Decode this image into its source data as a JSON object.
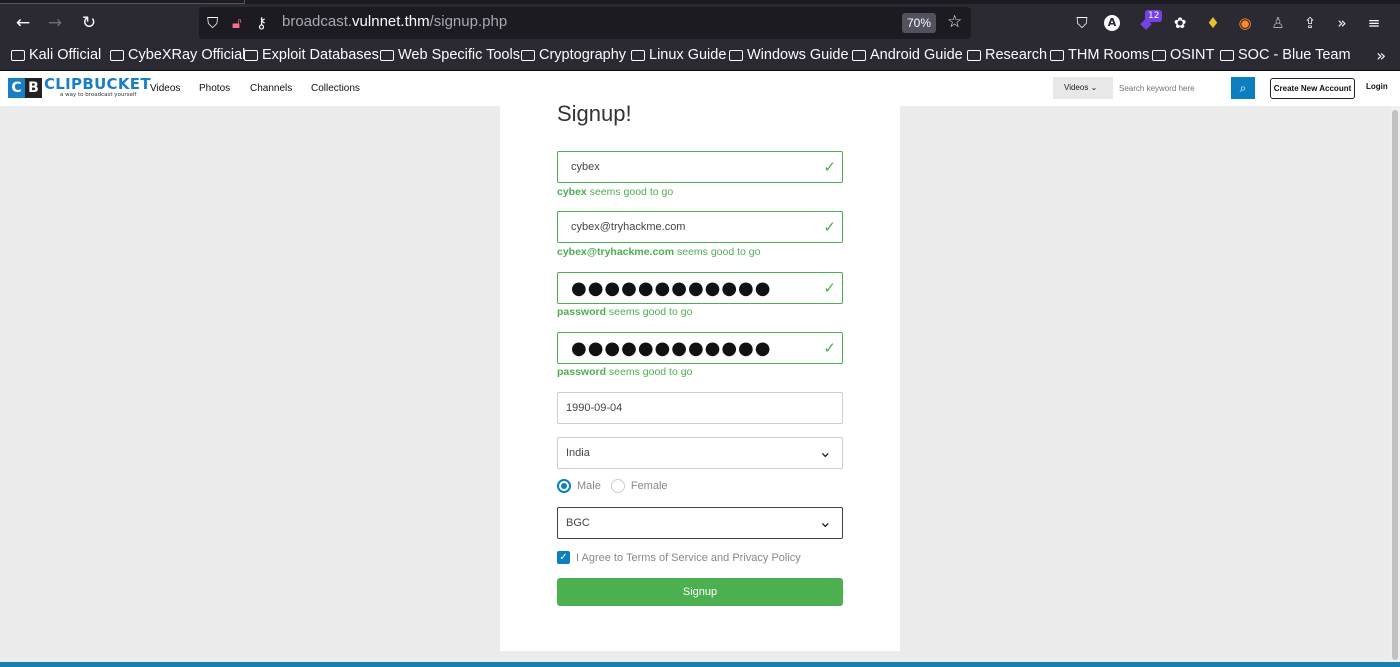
{
  "browser": {
    "url_prefix": "broadcast.",
    "url_domain": "vulnnet.thm",
    "url_path": "/signup.php",
    "zoom": "70%",
    "extension_badge": "12",
    "bookmarks": [
      "Kali Official",
      "CybeXRay Official",
      "Exploit Databases",
      "Web Specific Tools",
      "Cryptography",
      "Linux Guide",
      "Windows Guide",
      "Android Guide",
      "Research",
      "THM Rooms",
      "OSINT",
      "SOC - Blue Team"
    ]
  },
  "site": {
    "logo_letters": [
      "C",
      "B"
    ],
    "logo_text": "CLIPBUCKET",
    "tagline": "a way to broadcast yourself",
    "nav": [
      "Videos",
      "Photos",
      "Channels",
      "Collections"
    ],
    "search_category": "Videos",
    "search_placeholder": "Search keyword here",
    "create_account": "Create New Account",
    "login": "Login",
    "colors": {
      "brand": "#1a7ec6",
      "success": "#4caf50",
      "primary": "#0b7fc0"
    }
  },
  "form": {
    "title": "Signup!",
    "username": "cybex",
    "username_help_strong": "cybex",
    "username_help": " seems good to go",
    "email": "cybex@tryhackme.com",
    "email_help_strong": "cybex@tryhackme.com",
    "email_help": " seems good to go",
    "password_mask": "●●●●●●●●●●●●",
    "password_help_strong": "password",
    "password_help": " seems good to go",
    "confirm_mask": "●●●●●●●●●●●●",
    "confirm_help_strong": "password",
    "confirm_help": " seems good to go",
    "dob": "1990-09-04",
    "country": "India",
    "gender_male": "Male",
    "gender_female": "Female",
    "gender_selected": "Male",
    "category": "BGC",
    "agree_text": "I Agree to Terms of Service and Privacy Policy",
    "agree_checked": true,
    "submit": "Signup"
  }
}
